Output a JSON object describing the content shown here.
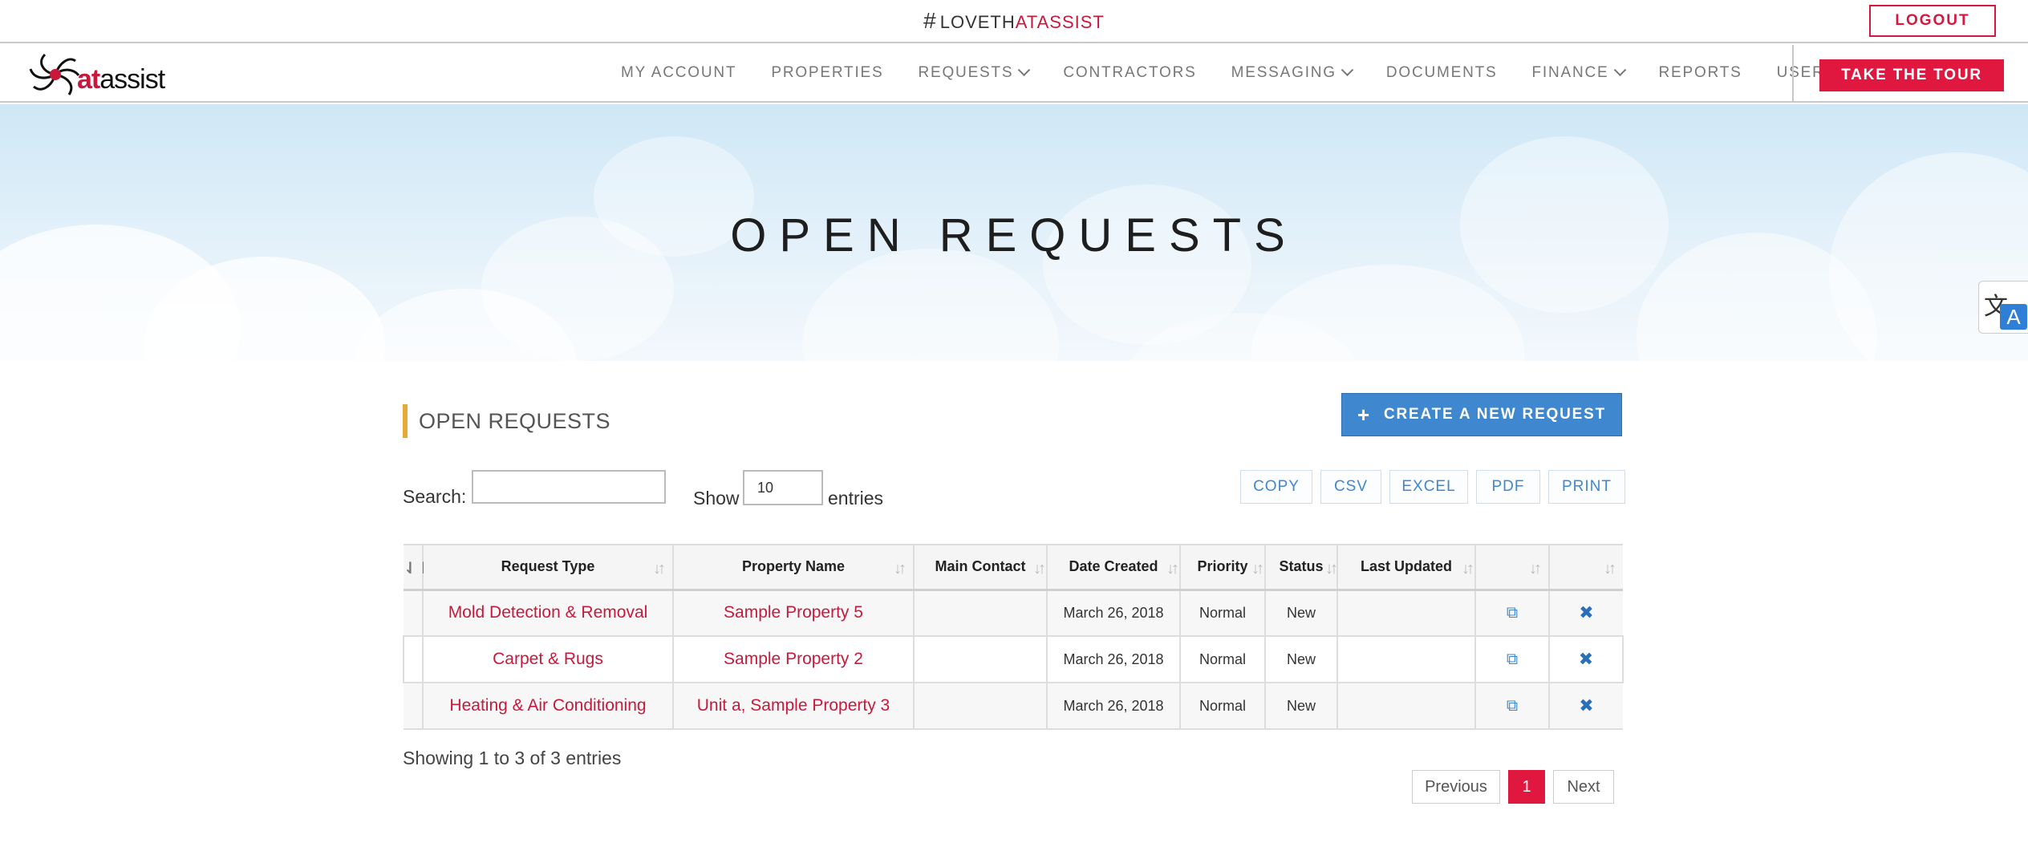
{
  "header": {
    "tagline_hash": "#",
    "tagline_main": "LOVETH",
    "tagline_accent": "ATASSIST",
    "logout_label": "LOGOUT"
  },
  "logo": {
    "text_at": "at",
    "text_rest": "assist"
  },
  "nav": {
    "items": [
      {
        "label": "MY ACCOUNT",
        "dropdown": false
      },
      {
        "label": "PROPERTIES",
        "dropdown": false
      },
      {
        "label": "REQUESTS",
        "dropdown": true
      },
      {
        "label": "CONTRACTORS",
        "dropdown": false
      },
      {
        "label": "MESSAGING",
        "dropdown": true
      },
      {
        "label": "DOCUMENTS",
        "dropdown": false
      },
      {
        "label": "FINANCE",
        "dropdown": true
      },
      {
        "label": "REPORTS",
        "dropdown": false
      },
      {
        "label": "USER",
        "dropdown": true
      }
    ],
    "tour_label": "TAKE THE TOUR"
  },
  "hero": {
    "title": "OPEN REQUESTS"
  },
  "translate": {
    "glyph_zh": "文",
    "glyph_a": "A"
  },
  "section": {
    "heading": "OPEN REQUESTS",
    "create_plus": "+",
    "create_label": "CREATE A NEW REQUEST"
  },
  "controls": {
    "search_label": "Search:",
    "search_value": "",
    "show_label": "Show",
    "show_value": "10",
    "entries_label": "entries",
    "export_buttons": [
      "COPY",
      "CSV",
      "EXCEL",
      "PDF",
      "PRINT"
    ]
  },
  "table": {
    "headers": [
      "",
      "Request Type",
      "Property Name",
      "Main Contact",
      "Date Created",
      "Priority",
      "Status",
      "Last Updated",
      "",
      ""
    ],
    "rows": [
      {
        "request_type": "Mold Detection & Removal",
        "property": "Sample Property 5",
        "contact": "",
        "date": "March 26, 2018",
        "priority": "Normal",
        "status": "New",
        "updated": ""
      },
      {
        "request_type": "Carpet & Rugs",
        "property": "Sample Property 2",
        "contact": "",
        "date": "March 26, 2018",
        "priority": "Normal",
        "status": "New",
        "updated": ""
      },
      {
        "request_type": "Heating & Air Conditioning",
        "property": "Unit a, Sample Property 3",
        "contact": "",
        "date": "March 26, 2018",
        "priority": "Normal",
        "status": "New",
        "updated": ""
      }
    ],
    "icons": {
      "copy": "copy-icon",
      "delete": "close-icon"
    }
  },
  "footer": {
    "showing": "Showing 1 to 3 of 3 entries",
    "prev_label": "Previous",
    "page_label": "1",
    "next_label": "Next"
  },
  "colors": {
    "brand": "#e0183f",
    "link": "#c8193c",
    "primary_blue": "#3f87cf",
    "heading_accent": "#e6a93c"
  }
}
